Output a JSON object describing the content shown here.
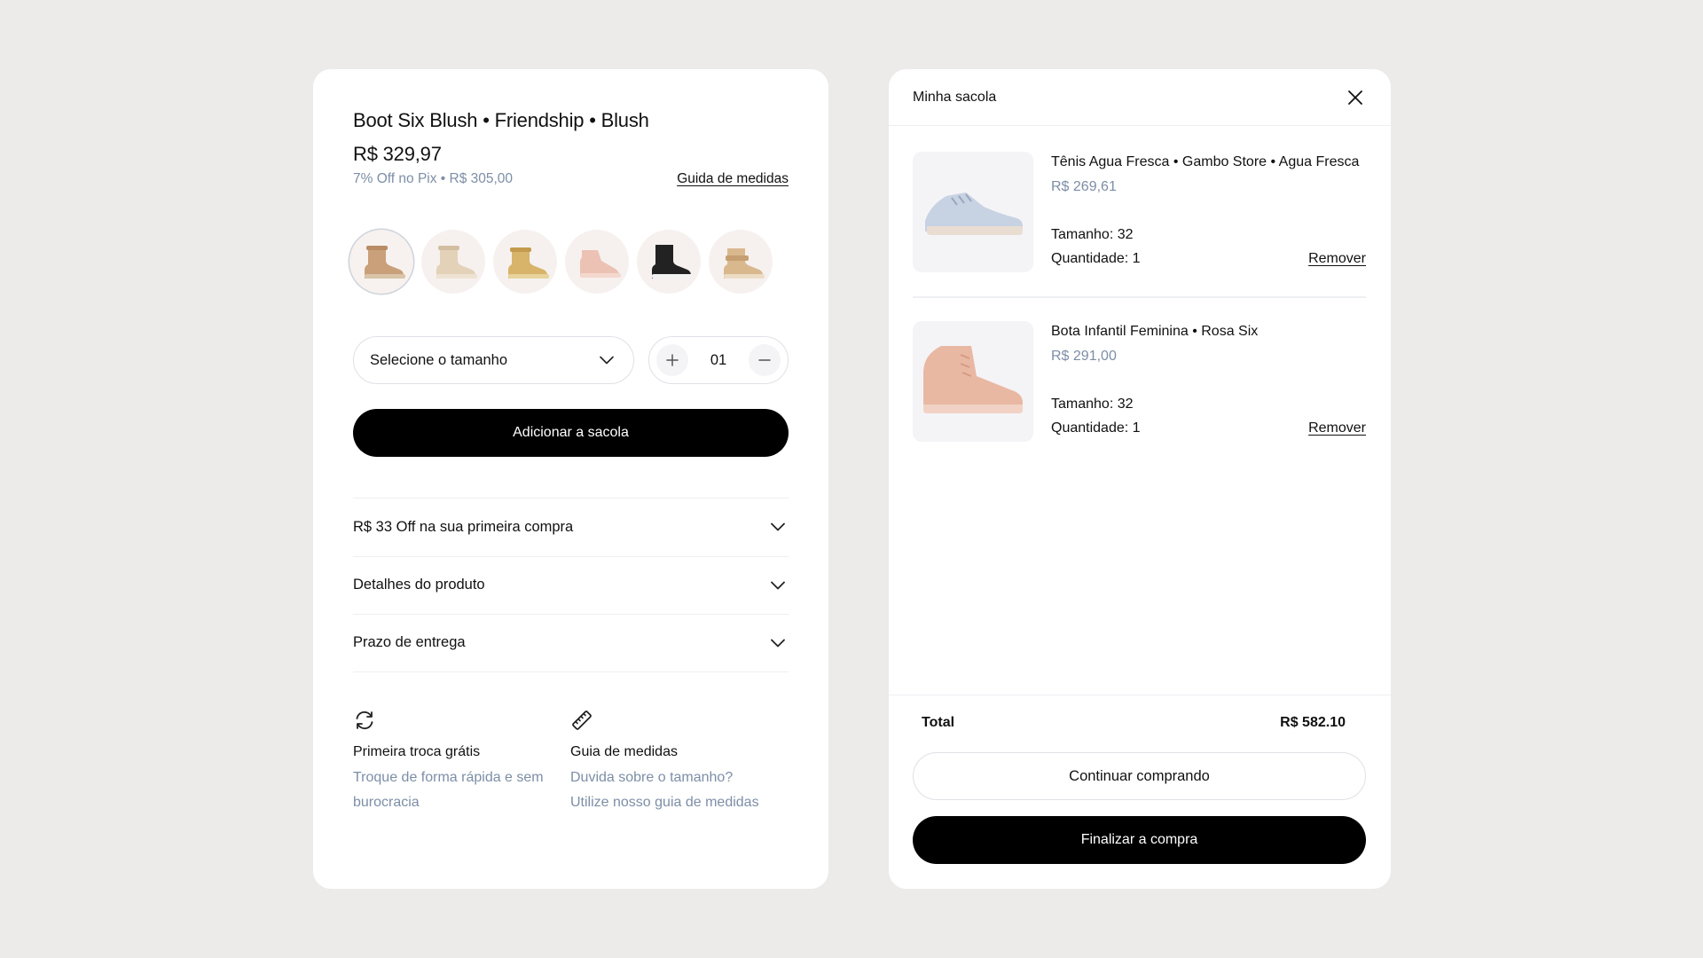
{
  "product": {
    "title": "Boot Six Blush • Friendship • Blush",
    "price": "R$ 329,97",
    "pix_offer": "7% Off no Pix • R$ 305,00",
    "size_guide_link": "Guida de medidas",
    "swatches": [
      {
        "name": "tan boot",
        "color": "#c9a07a"
      },
      {
        "name": "cream boot",
        "color": "#e3d2b8"
      },
      {
        "name": "gold boot",
        "color": "#d8b36a"
      },
      {
        "name": "pink sneaker",
        "color": "#ecc2b4"
      },
      {
        "name": "black boot",
        "color": "#222222"
      },
      {
        "name": "camel boot",
        "color": "#d9b88e"
      }
    ],
    "size_select": {
      "placeholder": "Selecione o tamanho"
    },
    "quantity": "01",
    "add_to_bag": "Adicionar a sacola",
    "accordion": [
      {
        "label": "R$ 33 Off na sua primeira compra"
      },
      {
        "label": "Detalhes do produto"
      },
      {
        "label": "Prazo de entrega"
      }
    ],
    "features": [
      {
        "icon": "refresh-icon",
        "title": "Primeira troca grátis",
        "description": "Troque de forma rápida e sem burocracia"
      },
      {
        "icon": "ruler-icon",
        "title": "Guia de medidas",
        "description": "Duvida sobre o tamanho? Utilize nosso guia de medidas"
      }
    ]
  },
  "bag": {
    "title": "Minha sacola",
    "items": [
      {
        "name": "Tênis Agua Fresca • Gambo Store • Agua Fresca",
        "price": "R$ 269,61",
        "size": "Tamanho: 32",
        "quantity": "Quantidade: 1",
        "remove_label": "Remover"
      },
      {
        "name": "Bota Infantil Feminina • Rosa Six",
        "price": "R$ 291,00",
        "size": "Tamanho: 32",
        "quantity": "Quantidade: 1",
        "remove_label": "Remover"
      }
    ],
    "total_label": "Total",
    "total_value": "R$ 582.10",
    "continue_label": "Continuar comprando",
    "checkout_label": "Finalizar a compra"
  },
  "colors": {
    "accent_muted": "#7d8ea6",
    "button_dark": "#000000",
    "background": "#ecebea"
  }
}
